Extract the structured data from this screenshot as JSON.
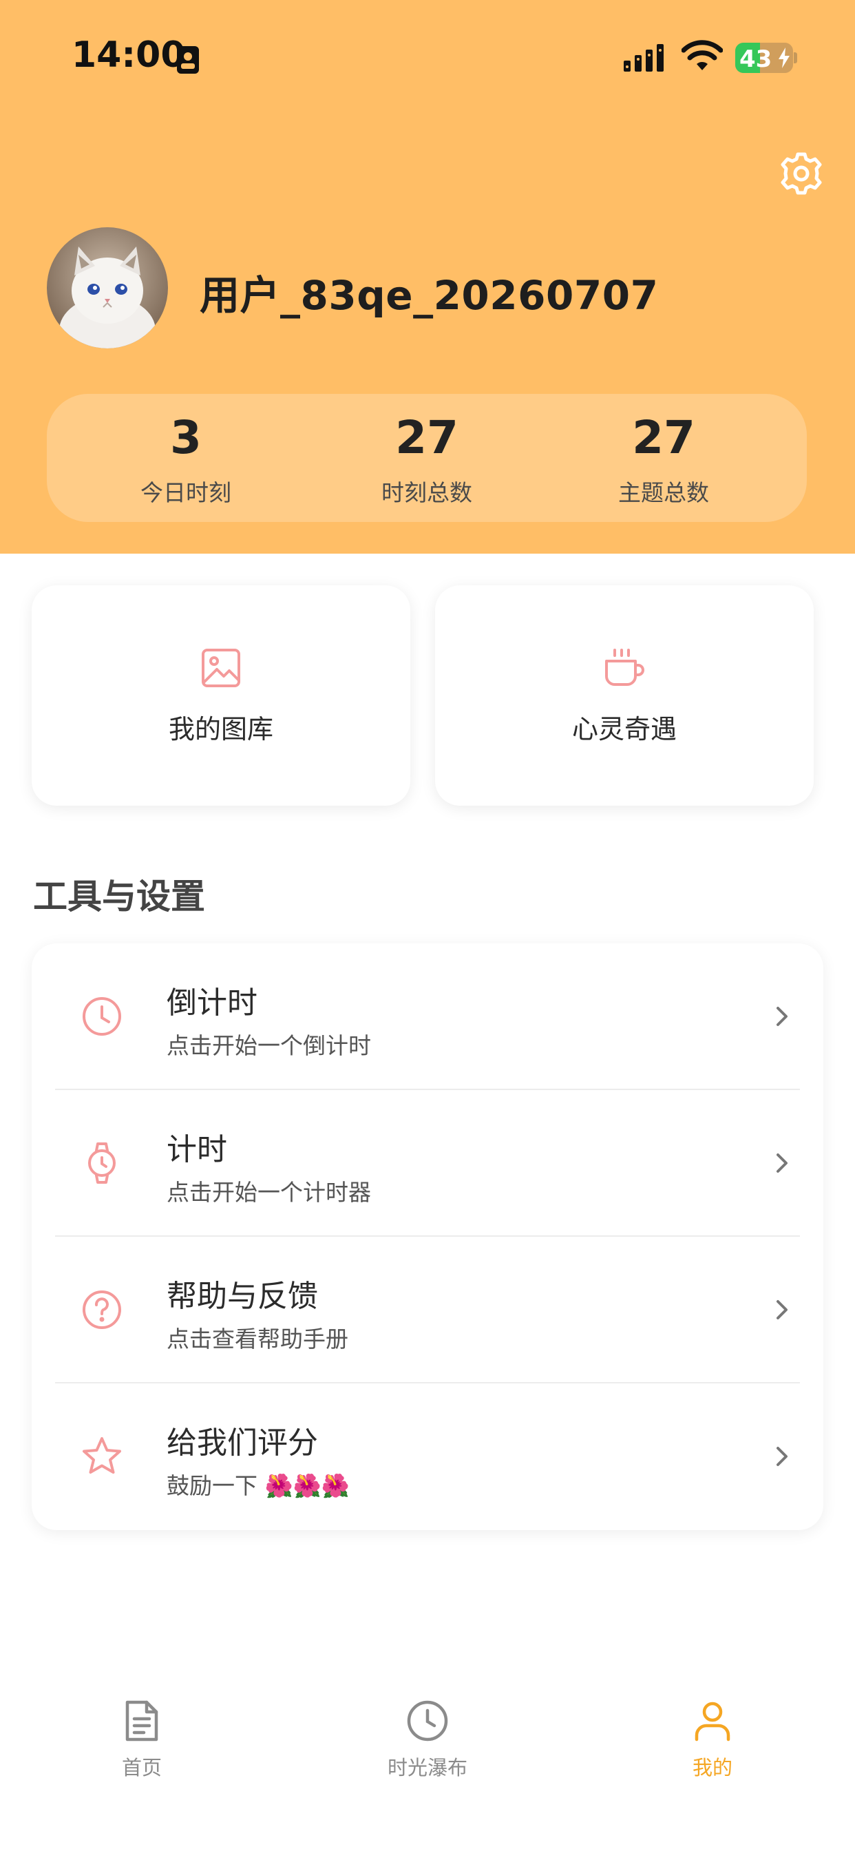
{
  "status_bar": {
    "time": "14:00",
    "battery": "43",
    "battery_level": 0.43
  },
  "colors": {
    "header_bg": "#FFBE66",
    "accent": "#F5A623",
    "icon_pink": "#F49A9A"
  },
  "profile": {
    "username": "用户_83qe_20260707"
  },
  "stats": [
    {
      "value": "3",
      "label": "今日时刻"
    },
    {
      "value": "27",
      "label": "时刻总数"
    },
    {
      "value": "27",
      "label": "主题总数"
    }
  ],
  "quick_cards": [
    {
      "icon": "image-icon",
      "label": "我的图库"
    },
    {
      "icon": "coffee-cup-icon",
      "label": "心灵奇遇"
    }
  ],
  "section_title": "工具与设置",
  "menu": [
    {
      "icon": "clock-icon",
      "title": "倒计时",
      "subtitle": "点击开始一个倒计时"
    },
    {
      "icon": "watch-icon",
      "title": "计时",
      "subtitle": "点击开始一个计时器"
    },
    {
      "icon": "question-icon",
      "title": "帮助与反馈",
      "subtitle": "点击查看帮助手册"
    },
    {
      "icon": "star-icon",
      "title": "给我们评分",
      "subtitle": "鼓励一下 🌺🌺🌺"
    }
  ],
  "tabs": [
    {
      "icon": "document-icon",
      "label": "首页"
    },
    {
      "icon": "clock-icon",
      "label": "时光瀑布"
    },
    {
      "icon": "person-icon",
      "label": "我的",
      "active": true
    }
  ]
}
